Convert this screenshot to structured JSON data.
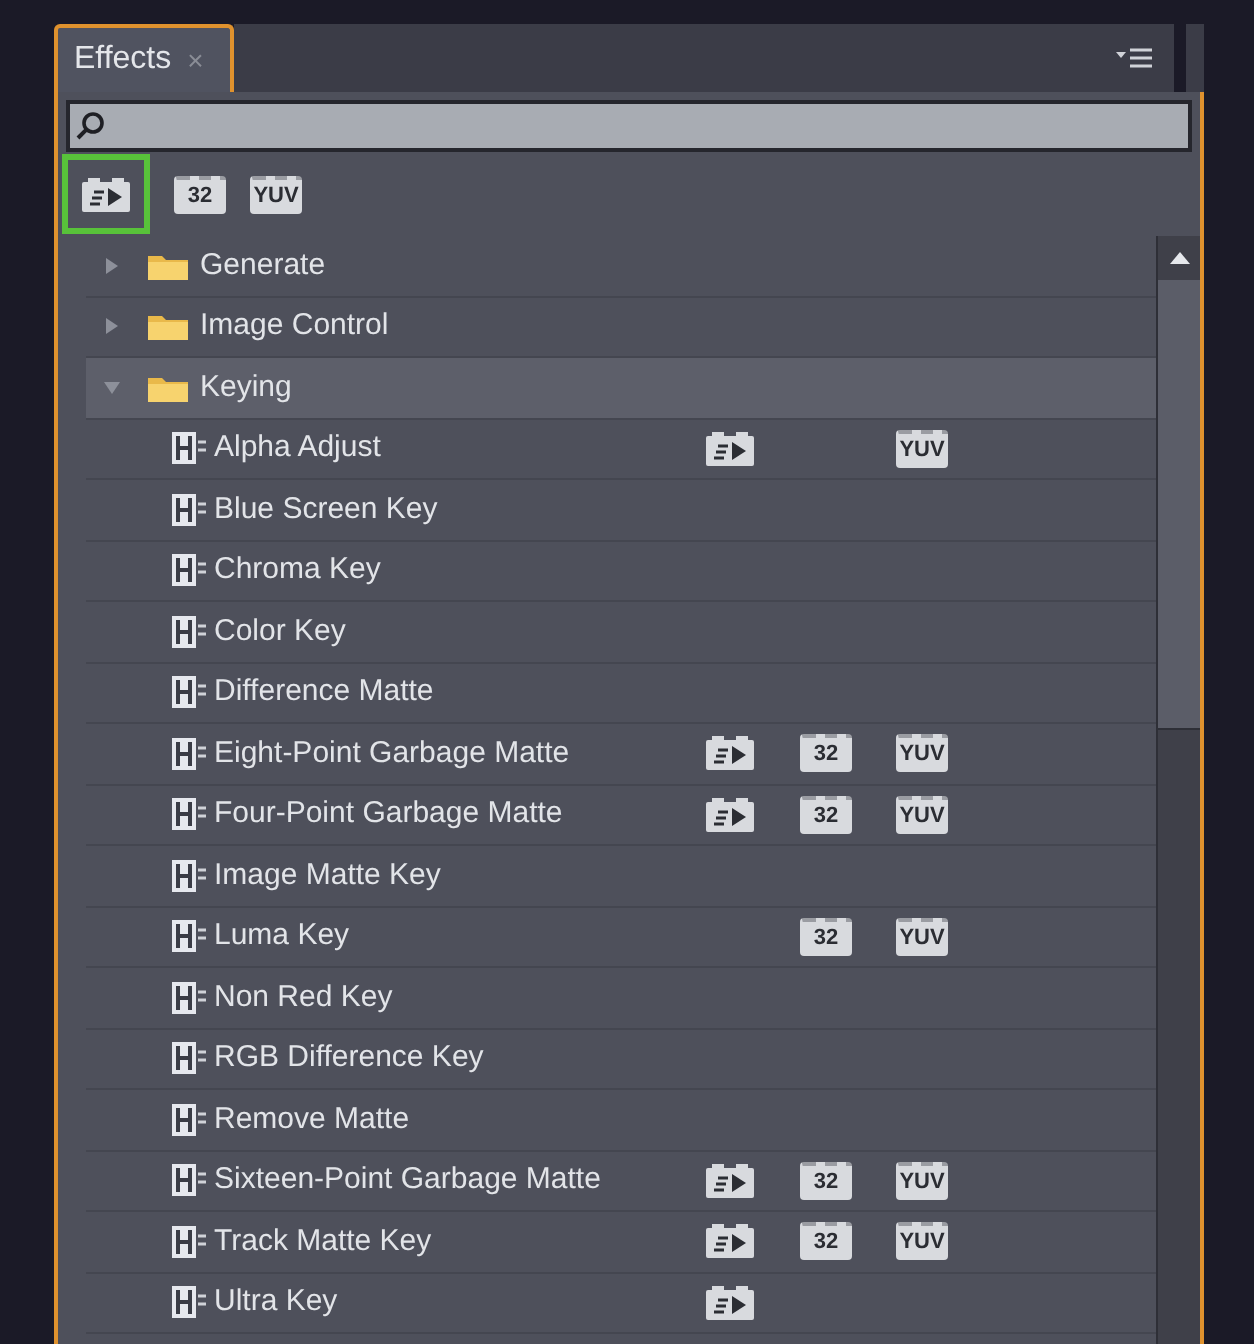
{
  "panel": {
    "tab": {
      "label": "Effects",
      "close": "×"
    }
  },
  "filters": [
    {
      "kind": "accelerated",
      "selected": true
    },
    {
      "kind": "text",
      "label": "32",
      "selected": false
    },
    {
      "kind": "text",
      "label": "YUV",
      "selected": false
    }
  ],
  "tree": [
    {
      "name": "Generate",
      "expanded": false,
      "selected": false
    },
    {
      "name": "Image Control",
      "expanded": false,
      "selected": false
    },
    {
      "name": "Keying",
      "expanded": true,
      "selected": true,
      "children": [
        {
          "name": "Alpha Adjust",
          "accelerated": true,
          "yuv": "YUV"
        },
        {
          "name": "Blue Screen Key",
          "accelerated": false
        },
        {
          "name": "Chroma Key",
          "accelerated": false
        },
        {
          "name": "Color Key",
          "accelerated": false
        },
        {
          "name": "Difference Matte",
          "accelerated": false
        },
        {
          "name": "Eight-Point Garbage Matte",
          "accelerated": true,
          "depth": "32",
          "yuv": "YUV"
        },
        {
          "name": "Four-Point Garbage Matte",
          "accelerated": true,
          "depth": "32",
          "yuv": "YUV"
        },
        {
          "name": "Image Matte Key",
          "accelerated": false
        },
        {
          "name": "Luma Key",
          "accelerated": false,
          "depth": "32",
          "yuv": "YUV"
        },
        {
          "name": "Non Red Key",
          "accelerated": false
        },
        {
          "name": "RGB Difference Key",
          "accelerated": false
        },
        {
          "name": "Remove Matte",
          "accelerated": false
        },
        {
          "name": "Sixteen-Point Garbage Matte",
          "accelerated": true,
          "depth": "32",
          "yuv": "YUV"
        },
        {
          "name": "Track Matte Key",
          "accelerated": true,
          "depth": "32",
          "yuv": "YUV"
        },
        {
          "name": "Ultra Key",
          "accelerated": true
        }
      ]
    }
  ]
}
